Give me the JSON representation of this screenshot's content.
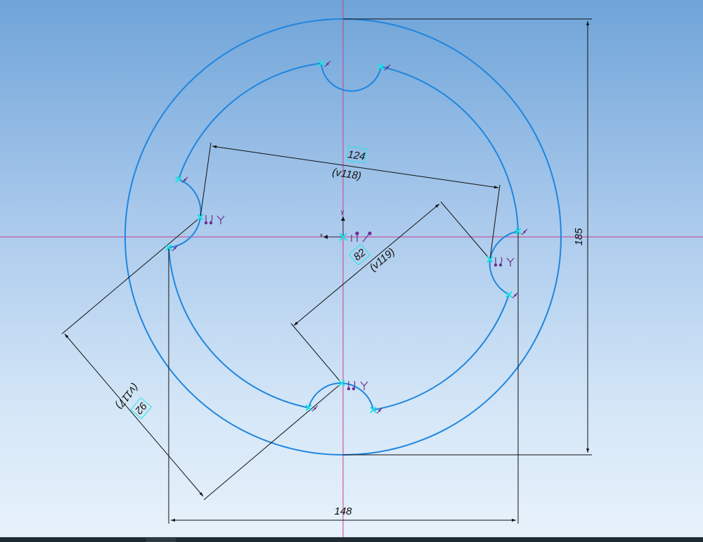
{
  "dimensions": {
    "d124": {
      "value": "124",
      "ref": "(v118)"
    },
    "d82": {
      "value": "82",
      "ref": "(v119)"
    },
    "d92": {
      "value": "92",
      "ref": "(v117)"
    },
    "d148": {
      "value": "148"
    },
    "d185": {
      "value": "185"
    }
  },
  "origin_axes": {
    "x_label": "x",
    "y_label": "y"
  },
  "colors": {
    "geometry": "#1f86df",
    "axis": "#c4418a",
    "dimension": "#111111",
    "constraint_point": "#19e3e3",
    "constraint_glyph": "#6b2c8e"
  },
  "icons": [
    "point-on-curve-icon",
    "coincident-constraint-icon",
    "tangent-constraint-icon",
    "origin-icon"
  ]
}
